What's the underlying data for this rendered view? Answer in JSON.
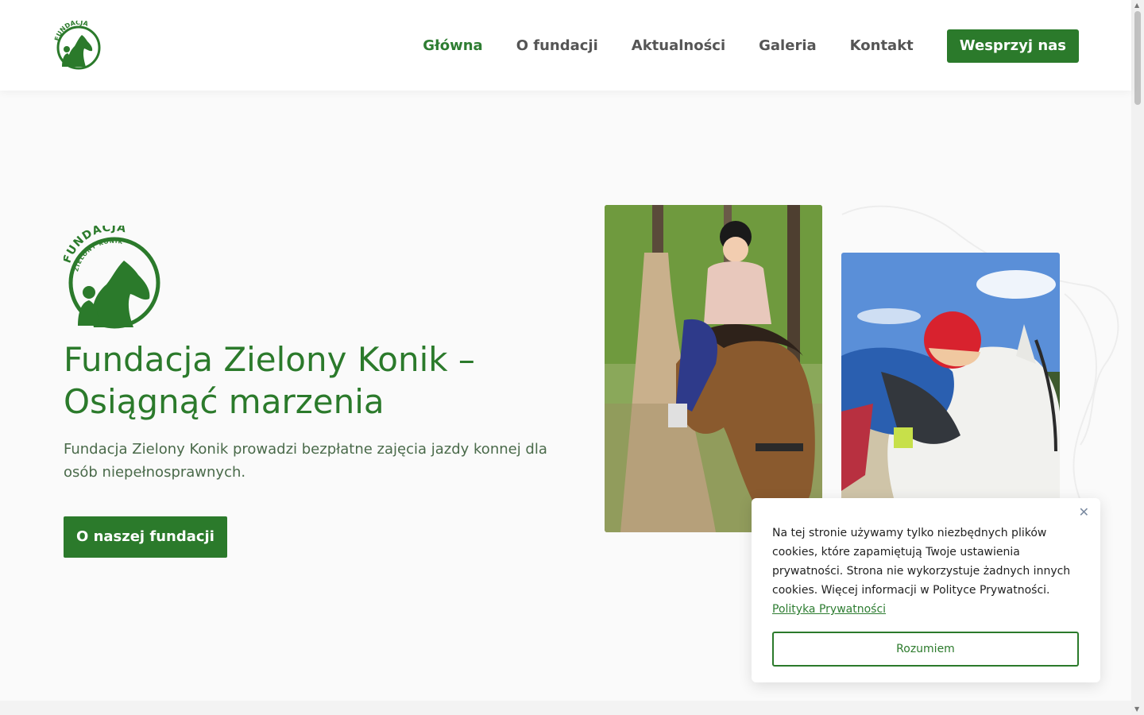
{
  "header": {
    "logo_top": "FUNDACJA",
    "logo_bottom": "ZIELONY KONIK",
    "nav": [
      {
        "label": "Główna",
        "active": true
      },
      {
        "label": "O fundacji"
      },
      {
        "label": "Aktualności"
      },
      {
        "label": "Galeria"
      },
      {
        "label": "Kontakt"
      }
    ],
    "cta_label": "Wesprzyj nas"
  },
  "hero": {
    "logo_top": "FUNDACJA",
    "logo_bottom": "ZIELONY KONIK",
    "title": "Fundacja Zielony Konik – Osiągnąć marzenia",
    "text": "Fundacja Zielony Konik prowadzi bezpłatne zajęcia jazdy konnej dla osób niepełnosprawnych.",
    "button_label": "O naszej fundacji"
  },
  "cookie": {
    "text": "Na tej stronie używamy tylko niezbędnych plików cookies, które zapamiętują Twoje ustawienia prywatności. Strona nie wykorzystuje żadnych innych cookies. Więcej informacji w Polityce Prywatności.",
    "link_label": "Polityka Prywatności",
    "button_label": "Rozumiem",
    "close_icon": "close-icon"
  },
  "colors": {
    "brand_green": "#2b7a2b",
    "active_nav": "#2e7d32"
  }
}
